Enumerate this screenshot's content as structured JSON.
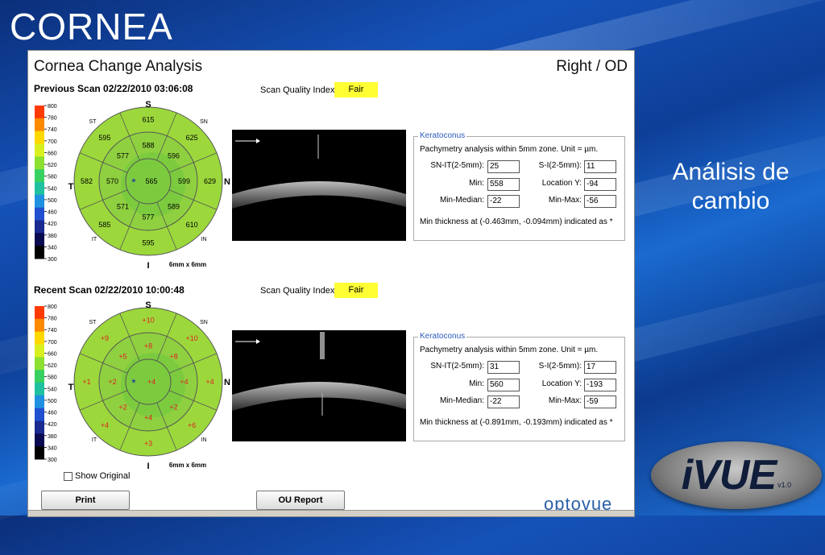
{
  "slide": {
    "title": "CORNEA",
    "side_text_line1": "Análisis de",
    "side_text_line2": "cambio",
    "logo_text": "iVUE",
    "logo_version": "v1.0"
  },
  "window": {
    "title": "Cornea Change Analysis",
    "eye": "Right / OD",
    "sqi_label": "Scan Quality Index",
    "map_size_label": "6mm x 6mm",
    "show_original_label": "Show Original",
    "print_button": "Print",
    "ou_report_button": "OU Report",
    "brand": "optovue",
    "colors": {
      "sqi_fair": "#ffff33",
      "keratoconus_legend": "#2a5bbf",
      "change_text": "#e02020"
    }
  },
  "color_scale": {
    "ticks": [
      "800",
      "780",
      "740",
      "700",
      "660",
      "620",
      "580",
      "540",
      "500",
      "460",
      "420",
      "380",
      "340",
      "300"
    ]
  },
  "orientation": {
    "top": "S",
    "bottom": "I",
    "left": "T",
    "right": "N",
    "st": "ST",
    "sn": "SN",
    "it": "IT",
    "in": "IN"
  },
  "scans": [
    {
      "label": "Previous Scan 02/22/2010 03:06:08",
      "sqi": "Fair",
      "map": {
        "center": "565",
        "inner": {
          "s": "588",
          "sn": "596",
          "n": "599",
          "in": "589",
          "i": "577",
          "it": "571",
          "t": "570",
          "st": "577"
        },
        "outer": {
          "s": "615",
          "sn": "625",
          "n": "629",
          "in": "610",
          "i": "595",
          "it": "585",
          "t": "582",
          "st": "595"
        }
      },
      "keratoconus": {
        "legend": "Keratoconus",
        "desc": "Pachymetry analysis within 5mm zone. Unit = µm.",
        "sn_it_label": "SN-IT(2-5mm):",
        "sn_it": "25",
        "s_i_label": "S-I(2-5mm):",
        "s_i": "11",
        "min_label": "Min:",
        "min": "558",
        "loc_y_label": "Location Y:",
        "loc_y": "-94",
        "min_median_label": "Min-Median:",
        "min_median": "-22",
        "min_max_label": "Min-Max:",
        "min_max": "-56",
        "footnote": "Min thickness at (-0.463mm, -0.094mm) indicated as *"
      }
    },
    {
      "label": "Recent Scan 02/22/2010 10:00:48",
      "sqi": "Fair",
      "map": {
        "center": "+4",
        "inner": {
          "s": "+8",
          "sn": "+8",
          "n": "+4",
          "in": "+2",
          "i": "+4",
          "it": "+2",
          "t": "+2",
          "st": "+5"
        },
        "outer": {
          "s": "+10",
          "sn": "+10",
          "n": "+4",
          "in": "+6",
          "i": "+3",
          "it": "+4",
          "t": "+1",
          "st": "+9"
        }
      },
      "keratoconus": {
        "legend": "Keratoconus",
        "desc": "Pachymetry analysis within 5mm zone. Unit = µm.",
        "sn_it_label": "SN-IT(2-5mm):",
        "sn_it": "31",
        "s_i_label": "S-I(2-5mm):",
        "s_i": "17",
        "min_label": "Min:",
        "min": "560",
        "loc_y_label": "Location Y:",
        "loc_y": "-193",
        "min_median_label": "Min-Median:",
        "min_median": "-22",
        "min_max_label": "Min-Max:",
        "min_max": "-59",
        "footnote": "Min thickness at (-0.891mm, -0.193mm) indicated as *"
      }
    }
  ]
}
